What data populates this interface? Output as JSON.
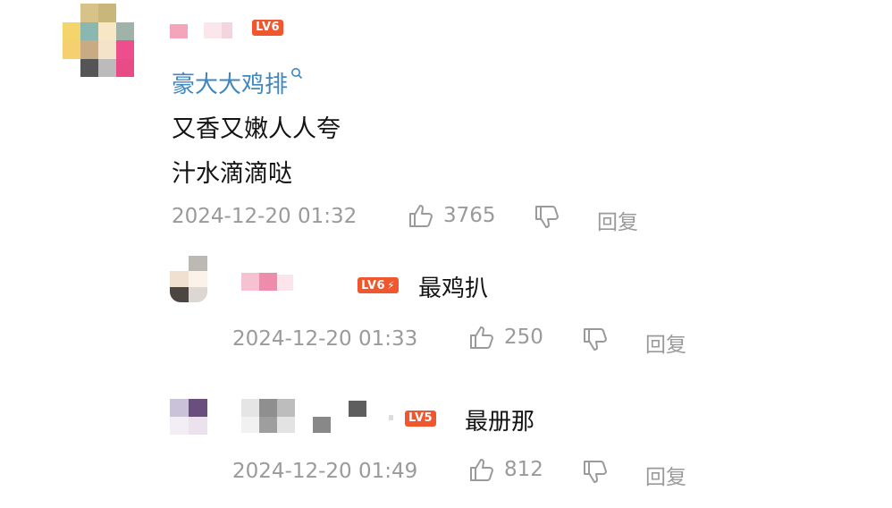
{
  "comment": {
    "level": "LV6",
    "topic": "豪大大鸡排",
    "lines": [
      "又香又嫩人人夸",
      "汁水滴滴哒"
    ],
    "time": "2024-12-20 01:32",
    "likes": "3765",
    "reply_label": "回复"
  },
  "replies": [
    {
      "level": "LV6",
      "level_bolt": "⚡",
      "text": "最鸡扒",
      "time": "2024-12-20 01:33",
      "likes": "250",
      "reply_label": "回复"
    },
    {
      "level": "LV5",
      "text": "最册那",
      "time": "2024-12-20 01:49",
      "likes": "812",
      "reply_label": "回复"
    }
  ],
  "colors": {
    "link": "#3f87bd",
    "badge": "#f0572f",
    "meta": "#9a9a9a"
  },
  "icons": [
    "search-icon",
    "thumbs-up-icon",
    "thumbs-down-icon"
  ]
}
